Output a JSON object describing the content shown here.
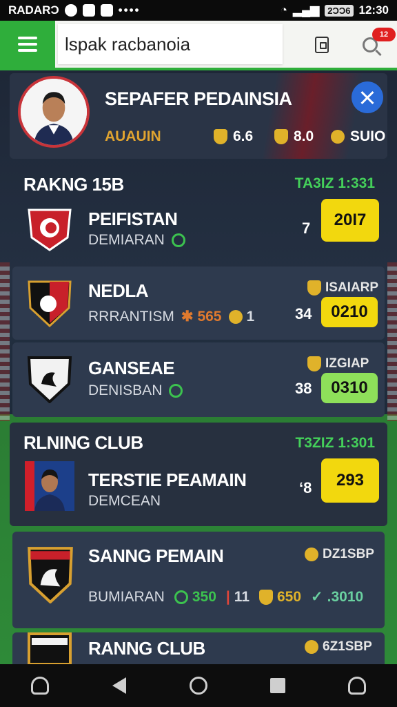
{
  "status_bar": {
    "carrier": "RADARƆ",
    "battery": "2ƆƆ6",
    "time": "12:30"
  },
  "search": {
    "value": "Ɩspak racbanoia"
  },
  "notification": {
    "count": "12"
  },
  "profile": {
    "name": "SEPAFER PEDAINSIA",
    "subtitle": "AUAUIN",
    "stat1": "6.6",
    "stat2": "8.0",
    "stat3": "SUIO"
  },
  "section1": {
    "title": "RAKNG 15B",
    "meta": "TA3IZ 1:331",
    "rows": [
      {
        "name": "PEIFISTAN",
        "sub": "DEMIARAN",
        "rank": "7",
        "score": "20Ɩ7"
      },
      {
        "name": "NEDLA",
        "sub": "RRRANTISM",
        "sub_stat": "565",
        "sub_stat2": "1",
        "tag": "ISAIARP",
        "rank": "34",
        "score": "0210"
      },
      {
        "name": "GANSEAE",
        "sub": "DENISBAN",
        "tag": "IZGIAP",
        "rank": "38",
        "score": "0310"
      }
    ]
  },
  "section2": {
    "title": "RLNING CLUB",
    "meta": "T3ZIZ 1:301",
    "rows": [
      {
        "name": "TERSTIE PEAMAIN",
        "sub": "DEMCEAN",
        "rank": "ʻ8",
        "score": "293"
      },
      {
        "name": "SANNG PEMAIN",
        "tag": "DZ1SBP",
        "sub": "BUMIARAN",
        "s1": "350",
        "s2": "11",
        "s3": "650",
        "s4": ".3010"
      },
      {
        "name": "RANNG CLUB",
        "tag": "6Z1SBP"
      }
    ]
  },
  "colors": {
    "accent": "#2fae3b",
    "highlight": "#f2d80e",
    "card": "#2e3a4e"
  }
}
